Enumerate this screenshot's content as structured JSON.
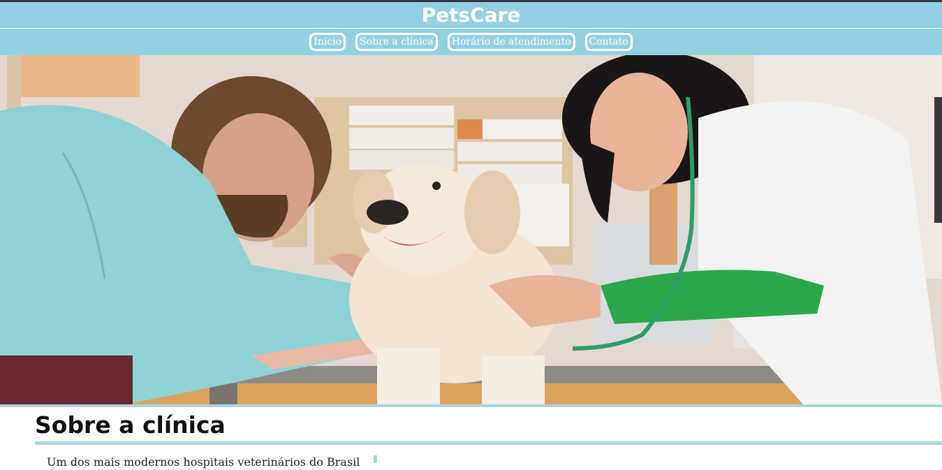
{
  "header": {
    "brand": "PetsCare"
  },
  "nav": {
    "items": [
      {
        "label": "Inicio"
      },
      {
        "label": "Sobre a clínica"
      },
      {
        "label": "Horário de atendimento"
      },
      {
        "label": "Contato"
      }
    ]
  },
  "hero": {
    "description": "veterinarians examining a golden retriever"
  },
  "about": {
    "title": "Sobre a clínica",
    "text": "Um dos mais modernos hospitais veterinários do Brasil"
  },
  "colors": {
    "header_bg": "#93d0e4",
    "accent_rule": "#a9d6e6",
    "top_bar": "#333940",
    "brand_text": "#ffffff"
  }
}
